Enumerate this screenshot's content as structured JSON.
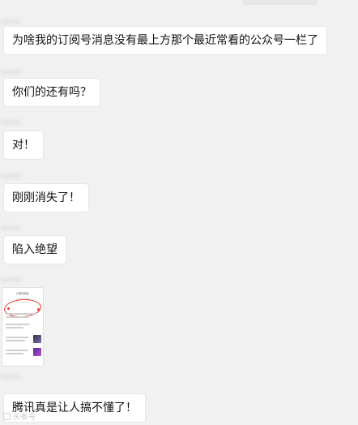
{
  "messages": [
    {
      "text": "为啥我的订阅号消息没有最上方那个最近常看的公众号一栏了"
    },
    {
      "text": "你们的还有吗？"
    },
    {
      "text": "对！"
    },
    {
      "text": "刚刚消失了！"
    },
    {
      "text": "陷入绝望"
    },
    {
      "text": "腾讯真是让人搞不懂了！"
    }
  ],
  "thumbnail": {
    "header_label": "订阅号消息"
  },
  "watermark": {
    "text": "头条号"
  },
  "colors": {
    "background": "#f1f1f1",
    "bubble": "#ffffff",
    "highlight_circle": "#e53935"
  }
}
